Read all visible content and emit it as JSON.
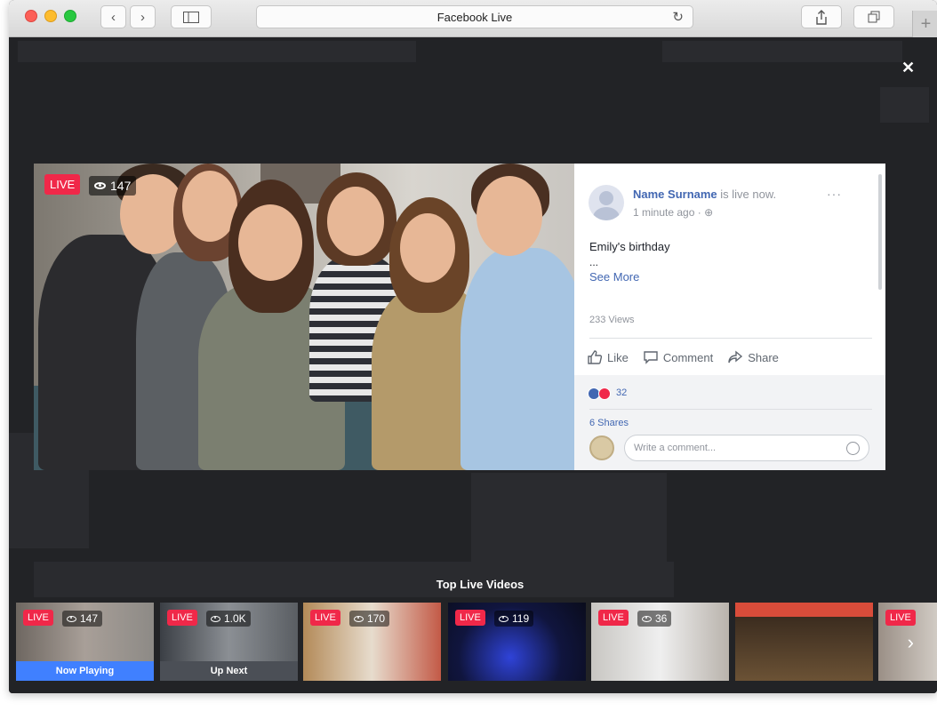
{
  "window": {
    "title": "Facebook Live"
  },
  "player": {
    "live_label": "LIVE",
    "viewer_count": "147"
  },
  "post": {
    "author": "Name Surname",
    "status_suffix": "is live now.",
    "time": "1 minute ago",
    "more": "···",
    "caption": "Emily's birthday",
    "ellipsis": "...",
    "see_more": "See More",
    "views": "233 Views",
    "actions": {
      "like": "Like",
      "comment": "Comment",
      "share": "Share"
    },
    "reaction_count": "32",
    "shares": "6 Shares",
    "comment_placeholder": "Write a comment..."
  },
  "carousel": {
    "title": "Top Live Videos",
    "items": [
      {
        "live": "LIVE",
        "views": "147",
        "label": "Now Playing"
      },
      {
        "live": "LIVE",
        "views": "1.0K",
        "label": "Up Next"
      },
      {
        "live": "LIVE",
        "views": "170"
      },
      {
        "live": "LIVE",
        "views": "119"
      },
      {
        "live": "LIVE",
        "views": "36"
      },
      {
        "live": "",
        "views": ""
      },
      {
        "live": "LIVE",
        "views": ""
      }
    ]
  },
  "colors": {
    "live_red": "#f02849",
    "fb_blue": "#4267b2",
    "now_playing": "#4080ff"
  }
}
